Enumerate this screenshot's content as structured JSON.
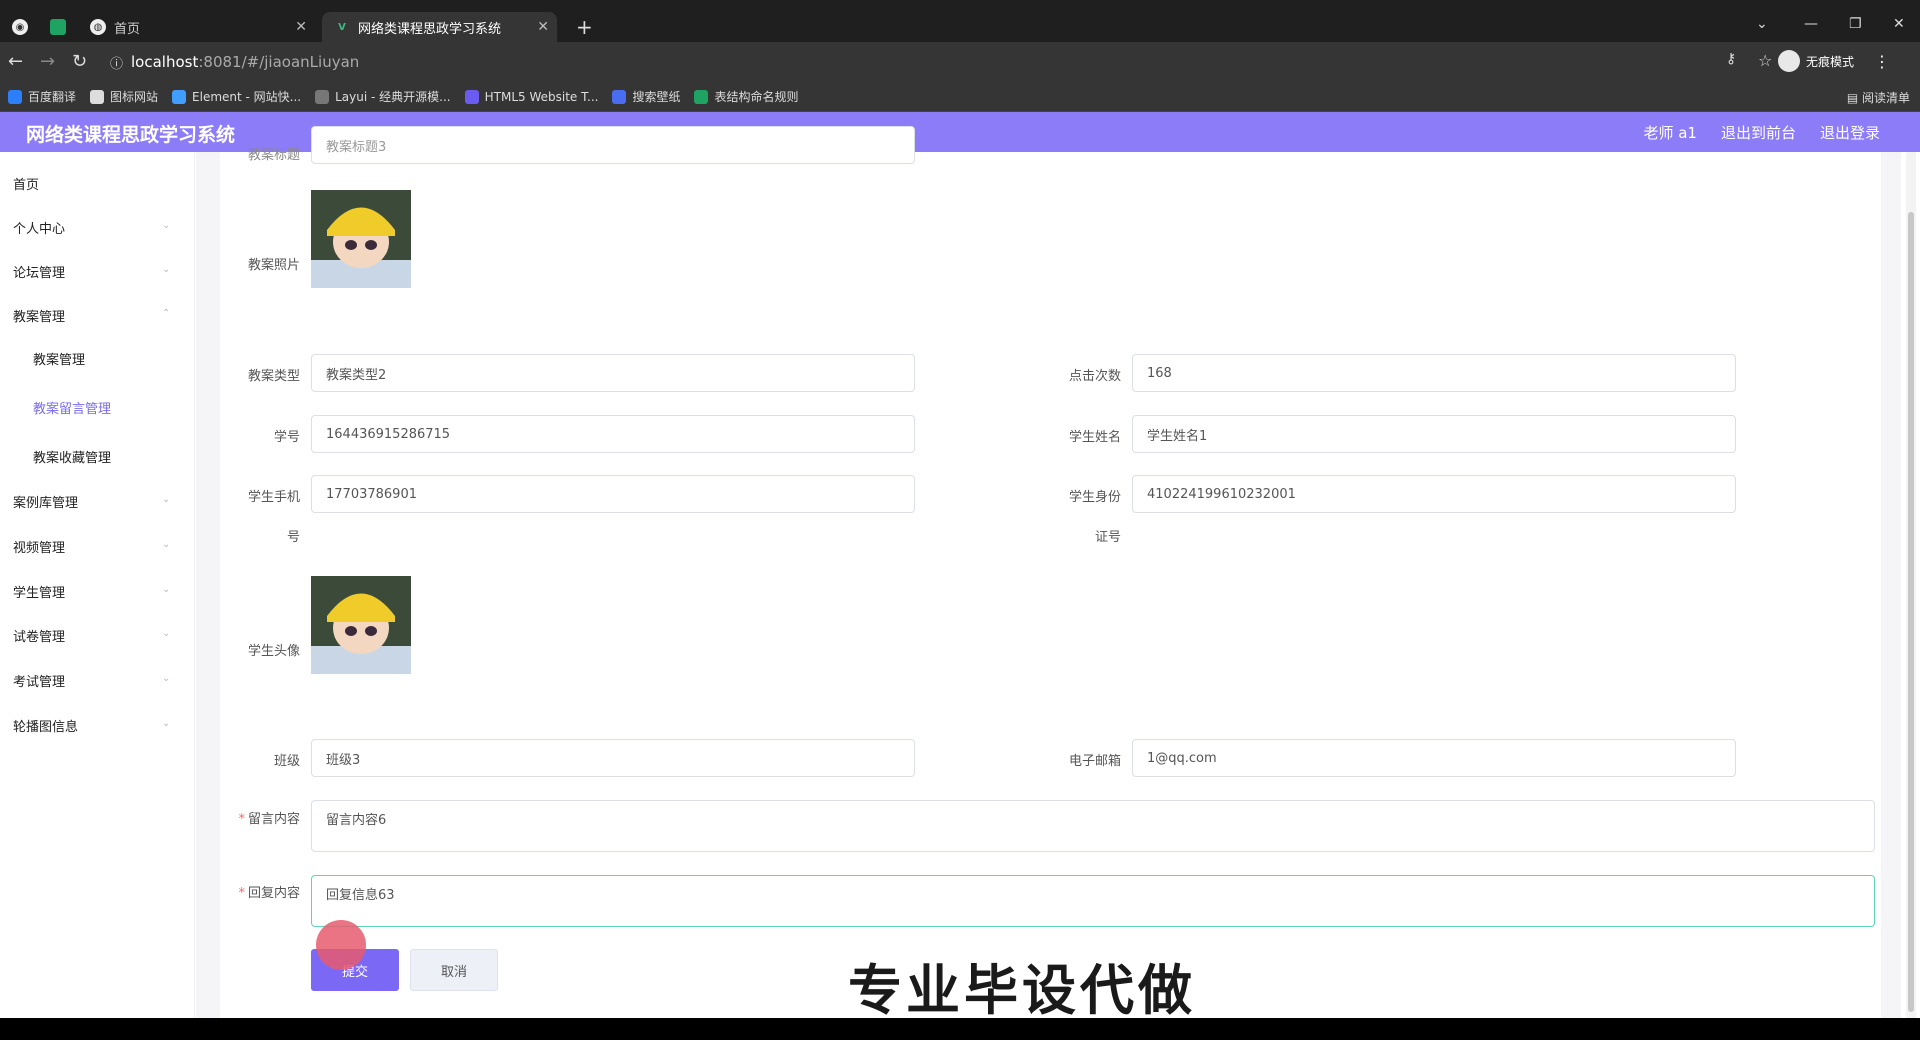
{
  "browser": {
    "tabs": [
      {
        "label": "首页",
        "favicon": "globe-icon"
      },
      {
        "label": "网络类课程思政学习系统",
        "favicon": "vue-icon"
      }
    ],
    "url_host": "localhost",
    "url_path": ":8081/#/jiaoanLiuyan",
    "incognito_label": "无痕模式",
    "bookmarks": [
      "百度翻译",
      "图标网站",
      "Element - 网站快...",
      "Layui - 经典开源模...",
      "HTML5 Website T...",
      "搜索壁纸",
      "表结构命名规则"
    ],
    "reading_list": "阅读清单"
  },
  "app": {
    "title": "网络类课程思政学习系统",
    "user": "老师 a1",
    "to_front": "退出到前台",
    "logout": "退出登录",
    "accent_color": "#8c7cf7"
  },
  "sidebar": {
    "items": [
      {
        "label": "首页"
      },
      {
        "label": "个人中心"
      },
      {
        "label": "论坛管理"
      },
      {
        "label": "教案管理"
      },
      {
        "label": "教案管理"
      },
      {
        "label": "教案留言管理"
      },
      {
        "label": "教案收藏管理"
      },
      {
        "label": "案例库管理"
      },
      {
        "label": "视频管理"
      },
      {
        "label": "学生管理"
      },
      {
        "label": "试卷管理"
      },
      {
        "label": "考试管理"
      },
      {
        "label": "轮播图信息"
      }
    ]
  },
  "form": {
    "top_partial_label": "教案标题",
    "top_partial_value": "教案标题3",
    "photo_label": "教案照片",
    "type_label": "教案类型",
    "type_value": "教案类型2",
    "clicks_label": "点击次数",
    "clicks_value": "168",
    "student_no_label": "学号",
    "student_no_value": "164436915286715",
    "student_name_label": "学生姓名",
    "student_name_value": "学生姓名1",
    "phone_label_1": "学生手机",
    "phone_label_2": "号",
    "phone_value": "17703786901",
    "id_label_1": "学生身份",
    "id_label_2": "证号",
    "id_value": "410224199610232001",
    "avatar_label": "学生头像",
    "class_label": "班级",
    "class_value": "班级3",
    "email_label": "电子邮箱",
    "email_value": "1@qq.com",
    "message_label": "留言内容",
    "message_value": "留言内容6",
    "reply_label": "回复内容",
    "reply_value": "回复信息63",
    "submit": "提交",
    "cancel": "取消"
  },
  "watermark": "专业毕设代做"
}
